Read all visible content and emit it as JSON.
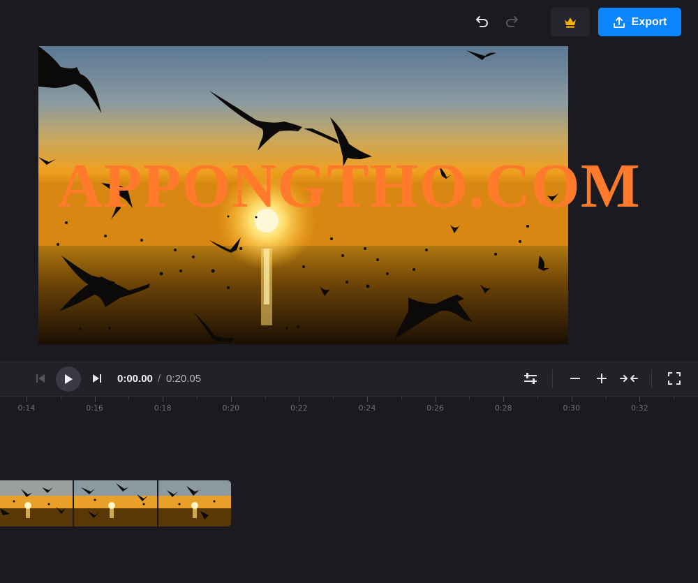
{
  "toolbar": {
    "undo_icon": "undo-icon",
    "redo_icon": "redo-icon",
    "premium_icon": "crown-icon",
    "export_label": "Export",
    "export_icon": "upload-icon",
    "accent_color": "#0a84ff",
    "crown_color": "#f5b400"
  },
  "preview": {
    "watermark": "APPONGTHO.COM",
    "watermark_color": "#ff7a2a"
  },
  "player": {
    "current_time": "0:00.00",
    "separator": "/",
    "total_time": "0:20.05"
  },
  "timeline": {
    "ruler_labels": [
      "0:14",
      "0:16",
      "0:18",
      "0:20",
      "0:22",
      "0:24",
      "0:26",
      "0:28",
      "0:30",
      "0:32"
    ]
  }
}
